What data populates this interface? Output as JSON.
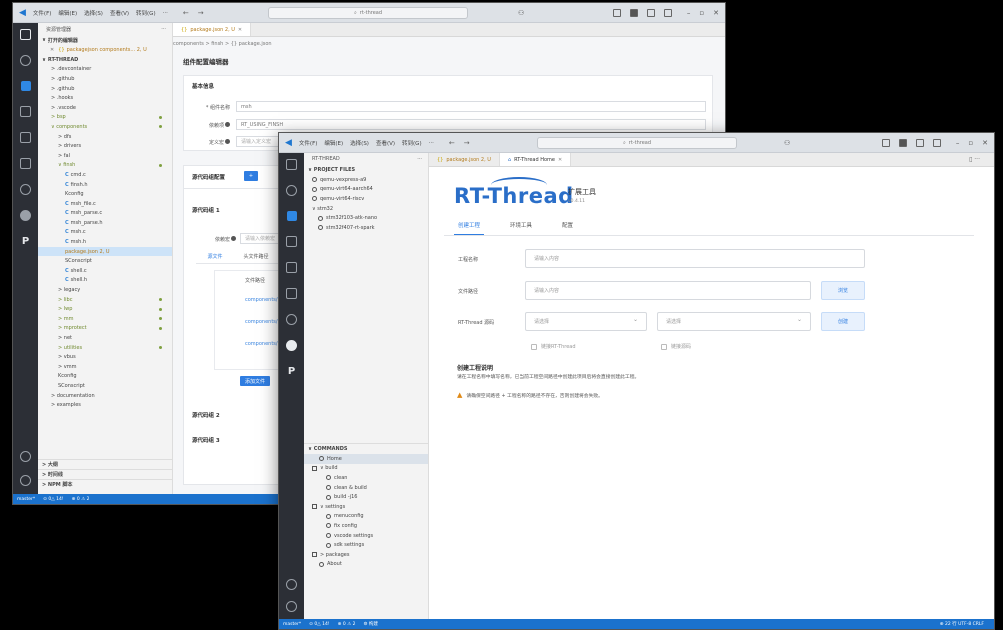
{
  "w1": {
    "menu": [
      "文件(F)",
      "编辑(E)",
      "选择(S)",
      "查看(V)",
      "转到(G)",
      "···"
    ],
    "search": "rt-thread",
    "sidebar": {
      "title": "资源管理器",
      "open_editors": "打开的编辑器",
      "open_file": "packagejson components... 2, U",
      "root": "RT-THREAD",
      "items": [
        {
          "label": "> .devcontainer",
          "indent": 1
        },
        {
          "label": "> .github",
          "indent": 1
        },
        {
          "label": "> .github",
          "indent": 1
        },
        {
          "label": "> .hooks",
          "indent": 1
        },
        {
          "label": "> .vscode",
          "indent": 1
        },
        {
          "label": "> bsp",
          "indent": 1,
          "mod": true
        },
        {
          "label": "∨ components",
          "indent": 1,
          "mod": true
        },
        {
          "label": "> dfs",
          "indent": 2
        },
        {
          "label": "> drivers",
          "indent": 2
        },
        {
          "label": "> fal",
          "indent": 2
        },
        {
          "label": "∨ finsh",
          "indent": 2,
          "mod": true
        },
        {
          "label": "cmd.c",
          "indent": 3,
          "c": true
        },
        {
          "label": "finsh.h",
          "indent": 3,
          "c": true
        },
        {
          "label": "Kconfig",
          "indent": 3
        },
        {
          "label": "msh_file.c",
          "indent": 3,
          "c": true
        },
        {
          "label": "msh_parse.c",
          "indent": 3,
          "c": true
        },
        {
          "label": "msh_parse.h",
          "indent": 3,
          "c": true
        },
        {
          "label": "msh.c",
          "indent": 3,
          "c": true
        },
        {
          "label": "msh.h",
          "indent": 3,
          "c": true
        },
        {
          "label": "package.json  2, U",
          "indent": 3,
          "sel": true,
          "untr": true
        },
        {
          "label": "SConscript",
          "indent": 3
        },
        {
          "label": "shell.c",
          "indent": 3,
          "c": true
        },
        {
          "label": "shell.h",
          "indent": 3,
          "c": true
        },
        {
          "label": "> legacy",
          "indent": 2
        },
        {
          "label": "> libc",
          "indent": 2,
          "mod": true
        },
        {
          "label": "> lwp",
          "indent": 2,
          "mod": true
        },
        {
          "label": "> mm",
          "indent": 2,
          "mod": true
        },
        {
          "label": "> mprotect",
          "indent": 2,
          "mod": true
        },
        {
          "label": "> net",
          "indent": 2
        },
        {
          "label": "> utilities",
          "indent": 2,
          "mod": true
        },
        {
          "label": "> vbus",
          "indent": 2
        },
        {
          "label": "> vmm",
          "indent": 2
        },
        {
          "label": "Kconfig",
          "indent": 2
        },
        {
          "label": "SConscript",
          "indent": 2
        },
        {
          "label": "> documentation",
          "indent": 1
        },
        {
          "label": "> examples",
          "indent": 1
        }
      ],
      "outline": "> 大纲",
      "timeline": "> 时间线",
      "npm": "> NPM 脚本"
    },
    "tab": "package.json  2, U",
    "breadcrumb": "components > finsh > {} package.json",
    "editor": {
      "title": "组件配置编辑器",
      "basic_header": "基本信息",
      "name_label": "* 组件名称",
      "name_value": "msh",
      "macro_label": "依赖项",
      "macro_value": "RT_USING_FINSH",
      "desc_label": "定义宏",
      "desc_placeholder": "请输入定义宏",
      "source_header": "源代码组配置",
      "add_btn": "+",
      "group1": "源代码组 1",
      "deps_label": "依赖宏",
      "deps_placeholder": "请输入依赖宏",
      "col1": "源文件",
      "col2": "头文件路径",
      "file_path": "文件路径",
      "link1": "components/finsh/cmd.c",
      "link2": "components/finsh/msh.c",
      "link3": "components/finsh/shell.c",
      "add_file_btn": "添加文件",
      "group2": "源代码组 2",
      "group3": "源代码组 3"
    },
    "status": [
      "master*",
      "⊙ 0△ 14!",
      "⊕ 0 ⚠ 2"
    ]
  },
  "w2": {
    "menu": [
      "文件(F)",
      "编辑(E)",
      "选择(S)",
      "查看(V)",
      "转到(G)",
      "···"
    ],
    "search": "rt-thread",
    "sidebar": {
      "title": "RT-THREAD",
      "project_files": "∨ PROJECT FILES",
      "projects": [
        "qemu-vexpress-a9",
        "qemu-virt64-aarch64",
        "qemu-virt64-riscv",
        "∨ stm32",
        "stm32f103-atk-nano",
        "stm32f407-rt-spark"
      ],
      "commands": "∨ COMMANDS",
      "cmds": [
        {
          "label": "Home",
          "indent": 1,
          "sel": true
        },
        {
          "label": "∨ build",
          "indent": 0
        },
        {
          "label": "clean",
          "indent": 2
        },
        {
          "label": "clean & build",
          "indent": 2
        },
        {
          "label": "build -j16",
          "indent": 2
        },
        {
          "label": "∨ settings",
          "indent": 0
        },
        {
          "label": "menuconfig",
          "indent": 2
        },
        {
          "label": "fix config",
          "indent": 2
        },
        {
          "label": "vscode settings",
          "indent": 2
        },
        {
          "label": "sdk settings",
          "indent": 2
        },
        {
          "label": "> packages",
          "indent": 0
        },
        {
          "label": "About",
          "indent": 1
        }
      ]
    },
    "tabs": [
      "package.json  2, U",
      "RT-Thread Home"
    ],
    "home": {
      "logo": "RT-Thread",
      "ext_title": "扩展工具",
      "ext_version": "v0.4.11",
      "subtabs": [
        "创建工程",
        "环境工具",
        "配置"
      ],
      "project_name_label": "工程名称",
      "project_name_ph": "请输入内容",
      "folder_label": "文件路径",
      "folder_ph": "请输入内容",
      "browse_btn": "浏览",
      "rtt_label": "RT-Thread 源码",
      "select_ph": "请选择",
      "select_ph2": "请选择",
      "create_btn": "创建",
      "check1": "链接RT-Thread",
      "check2": "链接源码",
      "desc_title": "创建工程说明",
      "desc_text": "请在工程名称中填写名称，已当前工程空间路径中创建此项目后将会直接创建此工程。",
      "warn_text": "请确保空间路径 + 工程名称的路径不存在，否则创建将会失败。"
    },
    "status_left": [
      "master*",
      "⊙ 0△ 14!",
      "⊕ 0 ⚠ 2",
      "⚙ 构建"
    ],
    "status_right": "⊕ 22 行 UTF-8 CRLF"
  }
}
